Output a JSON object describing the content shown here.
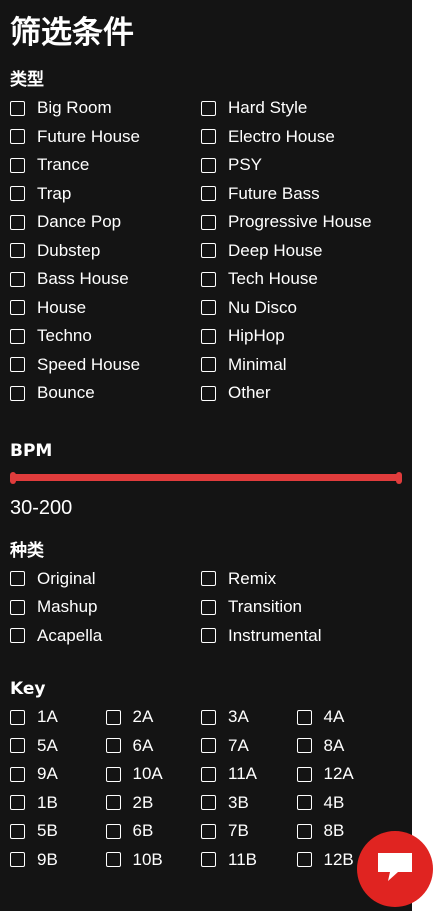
{
  "title": "筛选条件",
  "genre": {
    "title": "类型",
    "options": [
      "Big Room",
      "Hard Style",
      "Future House",
      "Electro House",
      "Trance",
      "PSY",
      "Trap",
      "Future Bass",
      "Dance Pop",
      "Progressive House",
      "Dubstep",
      "Deep House",
      "Bass House",
      "Tech House",
      "House",
      "Nu Disco",
      "Techno",
      "HipHop",
      "Speed House",
      "Minimal",
      "Bounce",
      "Other"
    ]
  },
  "bpm": {
    "title": "BPM",
    "min": 30,
    "max": 200,
    "range_text": "30-200",
    "accent_color": "#e03c3c"
  },
  "kind": {
    "title": "种类",
    "options": [
      "Original",
      "Remix",
      "Mashup",
      "Transition",
      "Acapella",
      "Instrumental"
    ]
  },
  "key": {
    "title": "Key",
    "options": [
      "1A",
      "2A",
      "3A",
      "4A",
      "5A",
      "6A",
      "7A",
      "8A",
      "9A",
      "10A",
      "11A",
      "12A",
      "1B",
      "2B",
      "3B",
      "4B",
      "5B",
      "6B",
      "7B",
      "8B",
      "9B",
      "10B",
      "11B",
      "12B"
    ]
  },
  "chat_button": {
    "icon": "chat-bubble-icon",
    "color": "#e02421"
  }
}
